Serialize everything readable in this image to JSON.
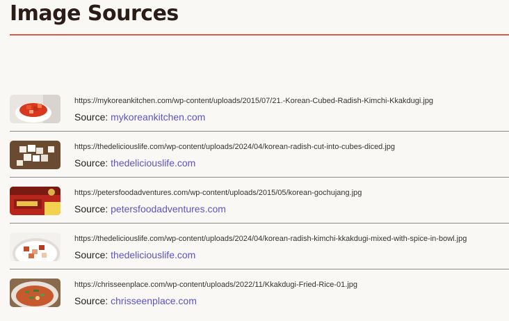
{
  "page": {
    "title": "Image Sources",
    "accent_color": "#d65a48",
    "link_color": "#5b53c7"
  },
  "sources": [
    {
      "url": "https://mykoreankitchen.com/wp-content/uploads/2015/07/21.-Korean-Cubed-Radish-Kimchi-Kkakdugi.jpg",
      "label": "Source:",
      "site": "mykoreankitchen.com",
      "thumb": "kimchi-bowl-thumbnail"
    },
    {
      "url": "https://thedeliciouslife.com/wp-content/uploads/2024/04/korean-radish-cut-into-cubes-diced.jpg",
      "label": "Source:",
      "site": "thedeliciouslife.com",
      "thumb": "radish-cubes-thumbnail"
    },
    {
      "url": "https://petersfoodadventures.com/wp-content/uploads/2015/05/korean-gochujang.jpg",
      "label": "Source:",
      "site": "petersfoodadventures.com",
      "thumb": "gochujang-tub-thumbnail"
    },
    {
      "url": "https://thedeliciouslife.com/wp-content/uploads/2024/04/korean-radish-kimchi-kkakdugi-mixed-with-spice-in-bowl.jpg",
      "label": "Source:",
      "site": "thedeliciouslife.com",
      "thumb": "spiced-radish-bowl-thumbnail"
    },
    {
      "url": "https://chrisseenplace.com/wp-content/uploads/2022/11/Kkakdugi-Fried-Rice-01.jpg",
      "label": "Source:",
      "site": "chrisseenplace.com",
      "thumb": "fried-rice-thumbnail"
    }
  ]
}
